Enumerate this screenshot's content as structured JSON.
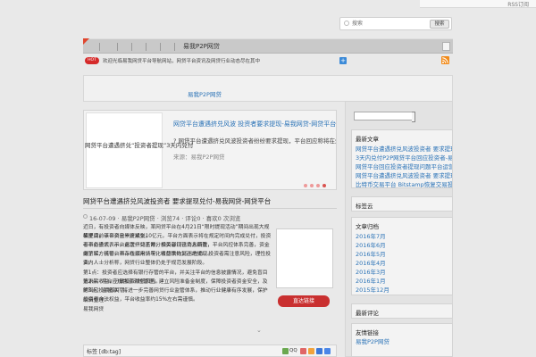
{
  "top": {
    "rss_label": "RSS订阅"
  },
  "search": {
    "placeholder": "搜索",
    "button_label": "搜索"
  },
  "nav": {
    "items": [
      "",
      "",
      "",
      "",
      "",
      ""
    ],
    "brand": "易我P2P网贷"
  },
  "ticker": {
    "badge": "HOT",
    "text": "欢迎光临易我网贷平台导航网站，网贷平台资讯及网贷行业动态尽在其中"
  },
  "banner": {
    "link_text": "易我P2P网贷"
  },
  "slider": {
    "image_text": "网贷平台遭遇挤兑“投资者提现”3天内兑付",
    "title": "网贷平台遭遇挤兑风波 投资者要求提现-易我网贷-网贷平台",
    "summary": "? 网贷平台遭遇挤兑风波投资者纷纷要求提现，平台回应称将在规定时间内完成兑付，投资者需理性看待",
    "more": "来源：易我P2P网贷"
  },
  "article": {
    "title": "网贷平台遭遇挤兑风波投资者 要求提现兑付-易我网贷-网贷平台",
    "meta": "16-07-09 · 易我P2P网贷 · 浏览74 · 评论0 · 喜欢0 次浏览",
    "paragraphs": [
      "近日，有投资者向媒体反映，某网贷平台在4月21日“限时提现活动”期间出现大规模提现，平台资金一度紧张。",
      "截至目前该平台已累计成交10亿元，平台方面表示将在规定时间内完成兑付，投资者不必恐慌，平台运营一切正常，相关部门已介入调查，",
      "平台负责人表示，此次挤兑系部分投资者误读消息所致，平台风控体系完善，资金由第三方托管，不存在挪用情况，将尽快恢复正常提现。",
      "据了解，该平台自上线以来，年化收益率约15%左右，投资者需注意风险，理性投资。",
      "业内人士分析称，网贷行业整体仍处于规范发展阶段。",
      "第1点：投资者应选择有银行存管的平台，并关注平台的信息披露情况，避免盲目追求高收益，分散投资降低风险。",
      "第2点：平台应加强流动性管理，建立风险准备金制度，保障投资者资金安全，及时回应投资者关切。",
      "第3点：监管部门将进一步完善网贷行业监管体系，推动行业健康有序发展，保护投资者合法权益，平台收益率约15%左右需谨慎。",
      "编辑整理：",
      "易我网贷"
    ],
    "direct_button": "直达链接",
    "more_arrow": "⌄"
  },
  "tags": {
    "label": "标签 [db:tag]"
  },
  "sidebar": {
    "widgets": [
      {
        "title": "最新文章",
        "lines": [
          "网贷平台遭遇挤兑风波投资者 要求提现兑付-易我网贷-",
          "3天内兑付P2P网贷平台回应投资者-易我网贷-网贷平台",
          "网贷平台回应投资者提现问题平台运营正常-易我网贷-网贷",
          "网贷平台遭遇挤兑风波投资者 要求提现兑付-易我网贷-网贷",
          "比特币交易平台 Bitstamp恢复交易投资者需谨慎对待风险"
        ]
      },
      {
        "title": "标签云",
        "lines": []
      },
      {
        "title": "文章归档",
        "lines": [
          "2016年7月",
          "2016年6月",
          "2016年5月",
          "2016年4月",
          "2016年3月",
          "2016年1月",
          "2015年12月"
        ]
      },
      {
        "title": "最新评论",
        "lines": []
      },
      {
        "title": "友情链接",
        "lines": [
          "易我P2P网贷"
        ]
      }
    ]
  },
  "colors": {
    "accent": "#2b73b7",
    "nav_bg": "#c9c9c9",
    "button_red": "#c93030",
    "badge_red": "#d52a2a"
  }
}
